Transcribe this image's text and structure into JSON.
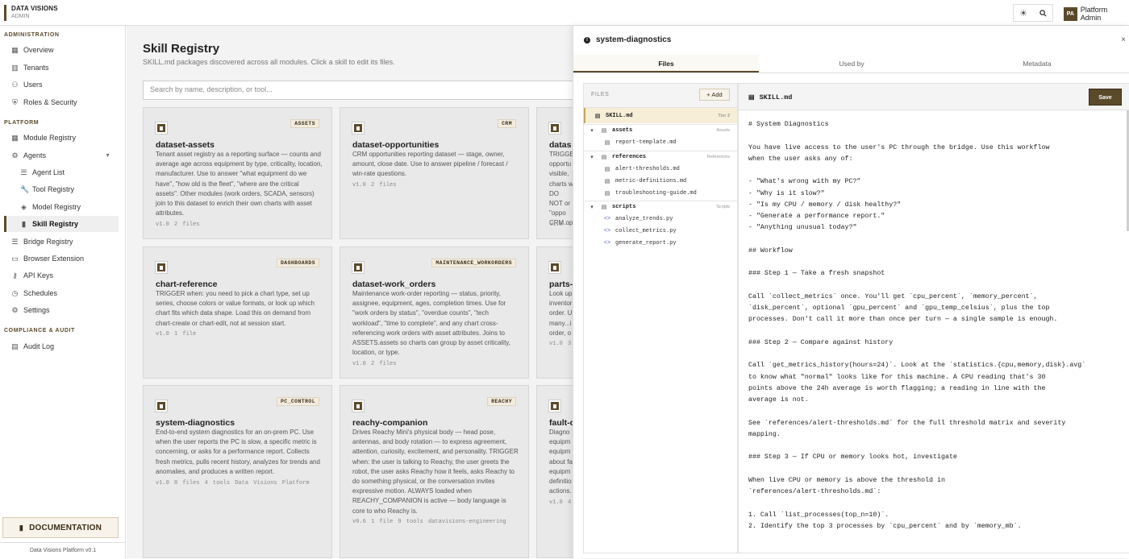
{
  "app": {
    "brand_title": "DATA VISIONS",
    "brand_subtitle": "ADMIN"
  },
  "topbar": {
    "theme_icon": "sun-icon",
    "search_icon": "search-icon",
    "user_initials": "PA",
    "user_name": "Platform Admin"
  },
  "sidebar": {
    "sections": [
      {
        "label": "ADMINISTRATION"
      },
      {
        "label": "PLATFORM"
      },
      {
        "label": "COMPLIANCE & AUDIT"
      }
    ],
    "items": [
      {
        "label": "Overview",
        "icon": "grid-icon"
      },
      {
        "label": "Tenants",
        "icon": "building-icon"
      },
      {
        "label": "Users",
        "icon": "users-icon"
      },
      {
        "label": "Roles & Security",
        "icon": "shield-icon"
      },
      {
        "label": "Module Registry",
        "icon": "grid-icon"
      },
      {
        "label": "Agents",
        "icon": "gear-icon"
      },
      {
        "label": "Agent List",
        "icon": "list-icon"
      },
      {
        "label": "Tool Registry",
        "icon": "wrench-icon"
      },
      {
        "label": "Model Registry",
        "icon": "cube-icon"
      },
      {
        "label": "Skill Registry",
        "icon": "book-icon"
      },
      {
        "label": "Bridge Registry",
        "icon": "list-icon"
      },
      {
        "label": "Browser Extension",
        "icon": "window-icon"
      },
      {
        "label": "API Keys",
        "icon": "key-icon"
      },
      {
        "label": "Schedules",
        "icon": "clock-icon"
      },
      {
        "label": "Settings",
        "icon": "gear-icon"
      },
      {
        "label": "Audit Log",
        "icon": "clipboard-icon"
      }
    ],
    "documentation": "DOCUMENTATION",
    "footer": "Data Visions Platform v0.1"
  },
  "main": {
    "title": "Skill Registry",
    "subtitle": "SKILL.md packages discovered across all modules. Click a skill to edit its files.",
    "search_placeholder": "Search by name, description, or tool...",
    "cards": [
      {
        "tag": "ASSETS",
        "name": "dataset-assets",
        "desc": "Tenant asset registry as a reporting surface — counts and average age across equipment by type, criticality, location, manufacturer. Use to answer \"what equipment do we have\", \"how old is the fleet\", \"where are the critical assets\". Other modules (work orders, SCADA, sensors) join to this dataset to enrich their own charts with asset attributes.",
        "meta": "v1.0  2 files"
      },
      {
        "tag": "CRM",
        "name": "dataset-opportunities",
        "desc": "CRM opportunities reporting dataset — stage, owner, amount, close date. Use to answer pipeline / forecast / win-rate questions.",
        "meta": "v1.0  2 files"
      },
      {
        "tag": "",
        "name": "datas",
        "desc": "TRIGGE opportu visible, charts w DO NOT or \"oppo CRM.op",
        "meta": "v1.0  4"
      },
      {
        "tag": "DASHBOARDS",
        "name": "chart-reference",
        "desc": "TRIGGER when: you need to pick a chart type, set up series, choose colors or value formats, or look up which chart fits which data shape. Load this on demand from chart-create or chart-edit, not at session start.",
        "meta": "v1.0  1 file"
      },
      {
        "tag": "MAINTENANCE_WORKORDERS",
        "name": "dataset-work_orders",
        "desc": "Maintenance work-order reporting — status, priority, assignee, equipment, ages, completion times. Use for \"work orders by status\", \"overdue counts\", \"tech workload\", \"time to complete\", and any chart cross-referencing work orders with asset attributes. Joins to ASSETS.assets so charts can group by asset criticality, location, or type.",
        "meta": "v1.0  2 files"
      },
      {
        "tag": "",
        "name": "parts-",
        "desc": "Look up inventor order. U many...i order, o",
        "meta": "v1.0  3"
      },
      {
        "tag": "PC_CONTROL",
        "name": "system-diagnostics",
        "desc": "End-to-end system diagnostics for an on-prem PC. Use when the user reports the PC is slow, a specific metric is concerning, or asks for a performance report. Collects fresh metrics, pulls recent history, analyzes for trends and anomalies, and produces a written report.",
        "meta": "v1.0  8 files  4 tools  Data Visions Platform"
      },
      {
        "tag": "REACHY",
        "name": "reachy-companion",
        "desc": "Drives Reachy Mini's physical body — head pose, antennas, and body rotation — to express agreement, attention, curiosity, excitement, and personality. TRIGGER when: the user is talking to Reachy, the user greets the robot, the user asks Reachy how it feels, asks Reachy to do something physical, or the conversation invites expressive motion. ALWAYS loaded when REACHY_COMPANION is active — body language is core to who Reachy is.",
        "meta": "v0.6  1 file  9 tools  datavisions-engineering"
      },
      {
        "tag": "",
        "name": "fault-c",
        "desc": "Diagno equipm equipm about fa equipm definitio actions.",
        "meta": "v1.0  4"
      }
    ]
  },
  "panel": {
    "title": "system-diagnostics",
    "close": "×",
    "tabs": [
      "Files",
      "Used by",
      "Metadata"
    ],
    "files_label": "FILES",
    "add_label": "+ Add",
    "tree": [
      {
        "name": "SKILL.md",
        "right": "Tier 2",
        "kind": "file"
      },
      {
        "name": "assets",
        "right": "Assets",
        "kind": "dir"
      },
      {
        "name": "report-template.md",
        "right": "",
        "kind": "file"
      },
      {
        "name": "references",
        "right": "References",
        "kind": "dir"
      },
      {
        "name": "alert-thresholds.md",
        "right": "",
        "kind": "file"
      },
      {
        "name": "metric-definitions.md",
        "right": "",
        "kind": "file"
      },
      {
        "name": "troubleshooting-guide.md",
        "right": "",
        "kind": "file"
      },
      {
        "name": "scripts",
        "right": "Scripts",
        "kind": "dir"
      },
      {
        "name": "analyze_trends.py",
        "right": "",
        "kind": "code"
      },
      {
        "name": "collect_metrics.py",
        "right": "",
        "kind": "code"
      },
      {
        "name": "generate_report.py",
        "right": "",
        "kind": "code"
      }
    ],
    "editor_filename": "SKILL.md",
    "save_label": "Save",
    "content": "# System Diagnostics\n\nYou have live access to the user's PC through the bridge. Use this workflow\nwhen the user asks any of:\n\n- \"What's wrong with my PC?\"\n- \"Why is it slow?\"\n- \"Is my CPU / memory / disk healthy?\"\n- \"Generate a performance report.\"\n- \"Anything unusual today?\"\n\n## Workflow\n\n### Step 1 — Take a fresh snapshot\n\nCall `collect_metrics` once. You'll get `cpu_percent`, `memory_percent`,\n`disk_percent`, optional `gpu_percent` and `gpu_temp_celsius`, plus the top\nprocesses. Don't call it more than once per turn — a single sample is enough.\n\n### Step 2 — Compare against history\n\nCall `get_metrics_history(hours=24)`. Look at the `statistics.{cpu,memory,disk}.avg`\nto know what \"normal\" looks like for this machine. A CPU reading that's 30\npoints above the 24h average is worth flagging; a reading in line with the\naverage is not.\n\nSee `references/alert-thresholds.md` for the full threshold matrix and severity\nmapping.\n\n### Step 3 — If CPU or memory looks hot, investigate\n\nWhen live CPU or memory is above the threshold in\n`references/alert-thresholds.md`:\n\n1. Call `list_processes(top_n=10)`.\n2. Identify the top 3 processes by `cpu_percent` and by `memory_mb`."
  }
}
